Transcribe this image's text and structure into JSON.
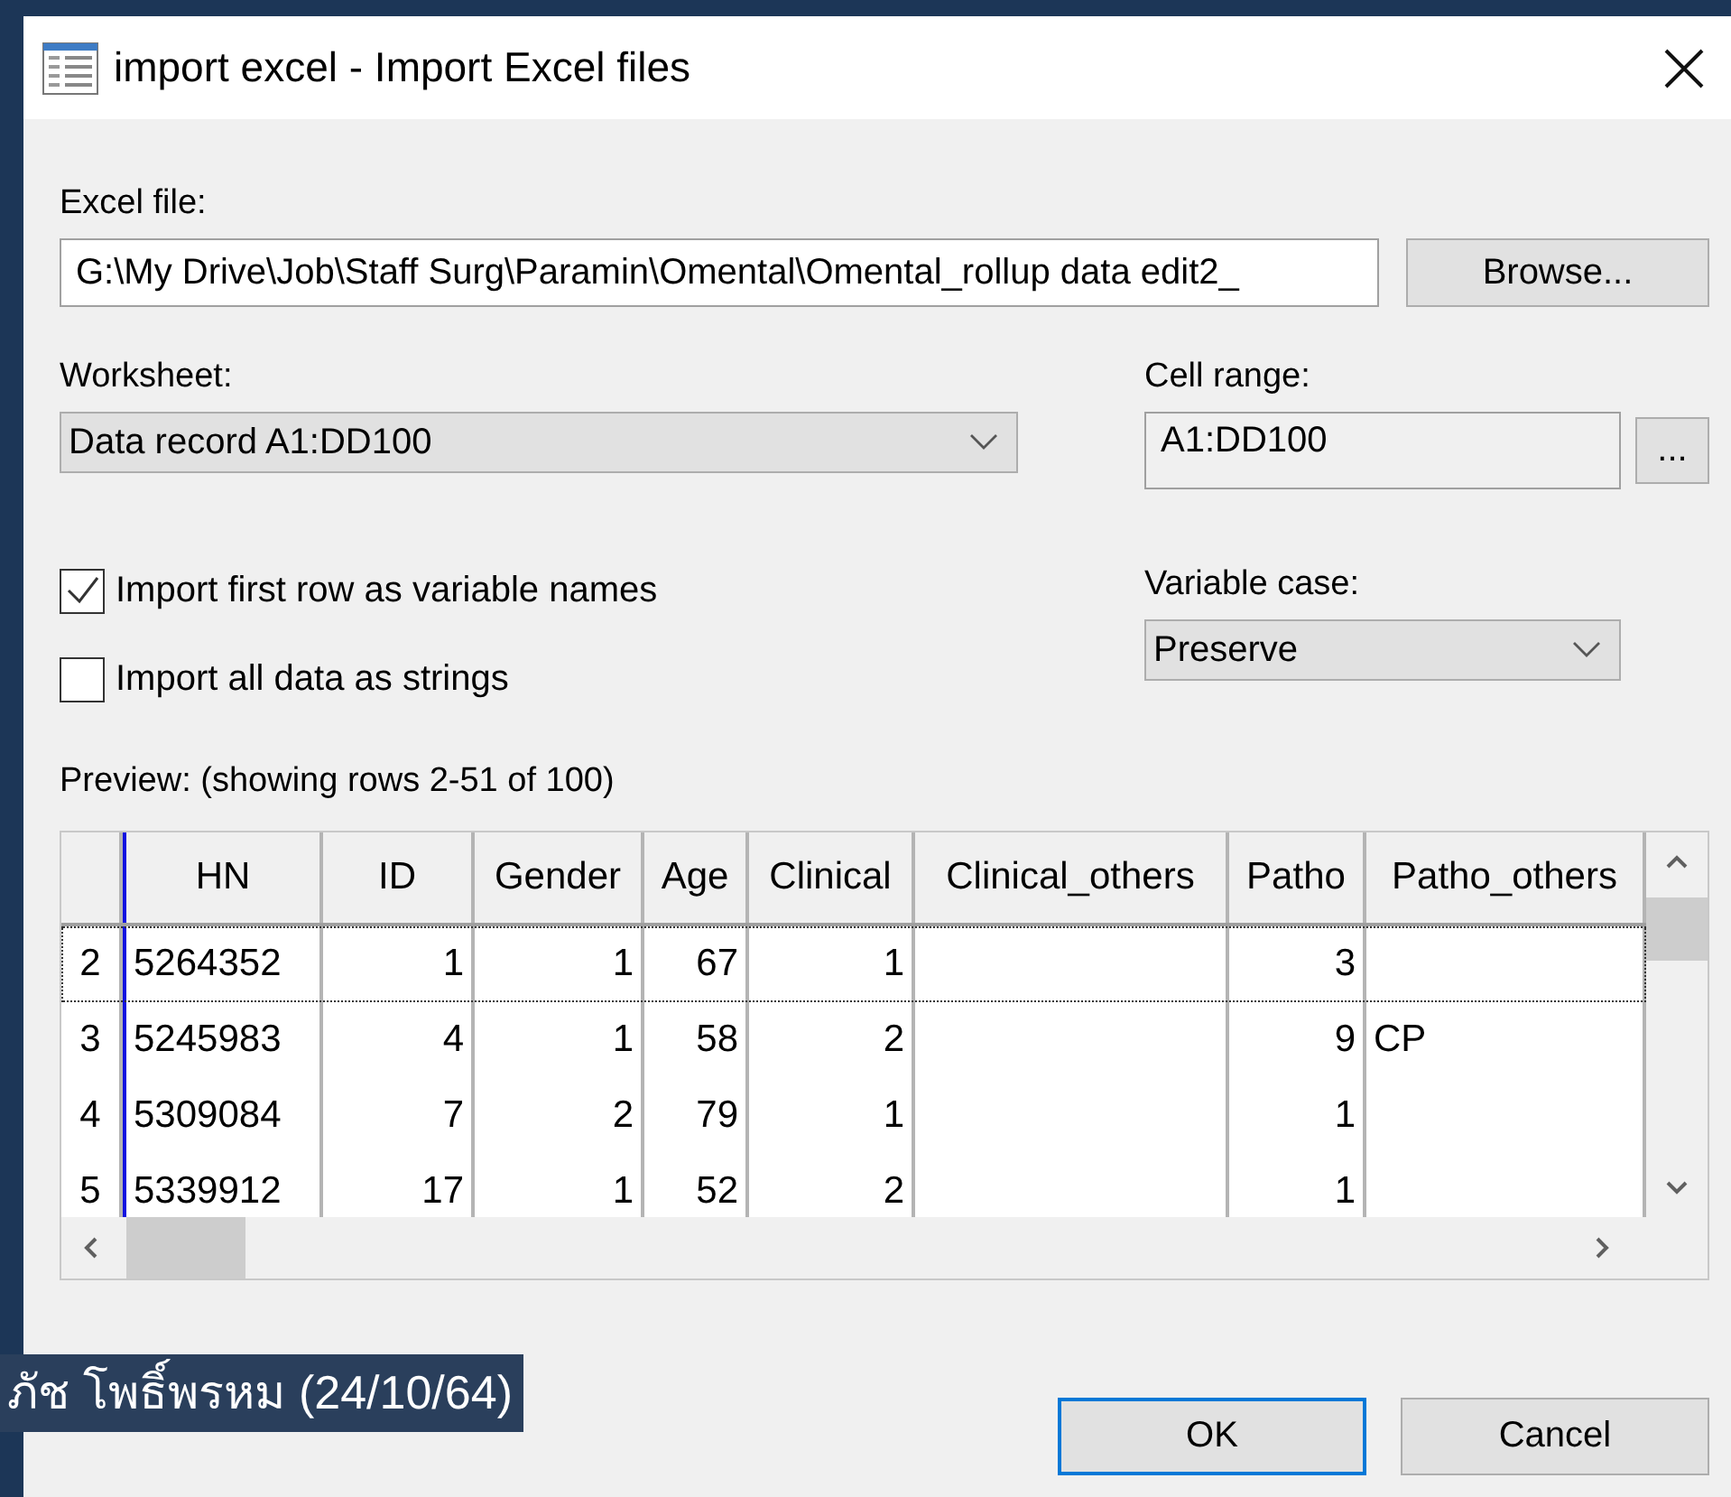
{
  "window": {
    "title": "import excel - Import Excel files"
  },
  "excel_file": {
    "label": "Excel file:",
    "value": "G:\\My Drive\\Job\\Staff Surg\\Paramin\\Omental\\Omental_rollup data edit2_",
    "browse": "Browse..."
  },
  "worksheet": {
    "label": "Worksheet:",
    "value": "Data record A1:DD100"
  },
  "cell_range": {
    "label": "Cell range:",
    "value": "A1:DD100",
    "button": "..."
  },
  "options": [
    {
      "label": "Import first row as variable names",
      "checked": true
    },
    {
      "label": "Import all data as strings",
      "checked": false
    }
  ],
  "variable_case": {
    "label": "Variable case:",
    "value": "Preserve"
  },
  "preview": {
    "label": "Preview: (showing rows 2-51 of 100)",
    "columns": [
      "",
      "HN",
      "ID",
      "Gender",
      "Age",
      "Clinical",
      "Clinical_others",
      "Patho",
      "Patho_others"
    ],
    "rows": [
      {
        "cells": [
          "2",
          "5264352",
          "1",
          "1",
          "67",
          "1",
          "",
          "3",
          ""
        ],
        "selected": true
      },
      {
        "cells": [
          "3",
          "5245983",
          "4",
          "1",
          "58",
          "2",
          "",
          "9",
          "CP"
        ],
        "selected": false
      },
      {
        "cells": [
          "4",
          "5309084",
          "7",
          "2",
          "79",
          "1",
          "",
          "1",
          ""
        ],
        "selected": false
      },
      {
        "cells": [
          "5",
          "5339912",
          "17",
          "1",
          "52",
          "2",
          "",
          "1",
          ""
        ],
        "selected": false
      }
    ]
  },
  "buttons": [
    {
      "label": "OK",
      "default": true
    },
    {
      "label": "Cancel",
      "default": false
    }
  ],
  "caption": "ภัช โพธิ์พรหม (24/10/64)"
}
